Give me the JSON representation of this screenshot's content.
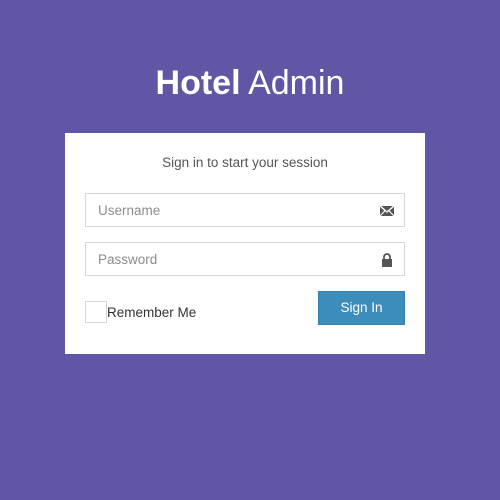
{
  "logo": {
    "bold": "Hotel",
    "light": "Admin"
  },
  "login": {
    "message": "Sign in to start your session",
    "username_placeholder": "Username",
    "password_placeholder": "Password",
    "remember_label": "Remember Me",
    "remember_checked": false,
    "signin_label": "Sign In"
  },
  "icons": {
    "username": "envelope-icon",
    "password": "lock-icon"
  },
  "colors": {
    "background": "#5f57a5",
    "box": "#ffffff",
    "button": "#3c8dbc",
    "button_text": "#ffffff"
  }
}
